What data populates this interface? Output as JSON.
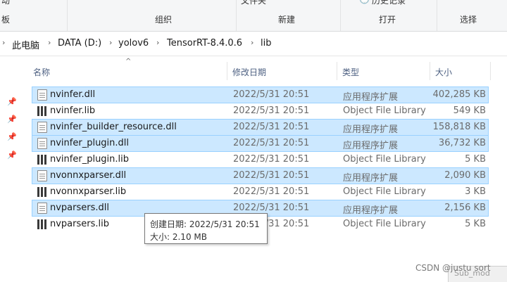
{
  "ribbon": {
    "clip_left_top": "动",
    "clip_left_bottom": "板",
    "clip_mid_top": "文件夹",
    "clip_right_top": "历史记录",
    "groups": {
      "organize": "组织",
      "new": "新建",
      "open": "打开",
      "select": "选择"
    }
  },
  "address": {
    "crumbs": [
      "此电脑",
      "DATA (D:)",
      "yolov6",
      "TensorRT-8.4.0.6",
      "lib"
    ]
  },
  "columns": {
    "name": "名称",
    "modified": "修改日期",
    "type": "类型",
    "size": "大小"
  },
  "files": [
    {
      "name": "nvinfer.dll",
      "modified": "2022/5/31 20:51",
      "type": "应用程序扩展",
      "size": "402,285 KB",
      "icon": "dll-file-icon",
      "selected": true
    },
    {
      "name": "nvinfer.lib",
      "modified": "2022/5/31 20:51",
      "type": "Object File Library",
      "size": "549 KB",
      "icon": "lib-file-icon",
      "selected": false
    },
    {
      "name": "nvinfer_builder_resource.dll",
      "modified": "2022/5/31 20:51",
      "type": "应用程序扩展",
      "size": "158,818 KB",
      "icon": "dll-file-icon",
      "selected": true
    },
    {
      "name": "nvinfer_plugin.dll",
      "modified": "2022/5/31 20:51",
      "type": "应用程序扩展",
      "size": "36,732 KB",
      "icon": "dll-file-icon",
      "selected": true
    },
    {
      "name": "nvinfer_plugin.lib",
      "modified": "2022/5/31 20:51",
      "type": "Object File Library",
      "size": "5 KB",
      "icon": "lib-file-icon",
      "selected": false
    },
    {
      "name": "nvonnxparser.dll",
      "modified": "2022/5/31 20:51",
      "type": "应用程序扩展",
      "size": "2,090 KB",
      "icon": "dll-file-icon",
      "selected": true
    },
    {
      "name": "nvonnxparser.lib",
      "modified": "2022/5/31 20:51",
      "type": "Object File Library",
      "size": "3 KB",
      "icon": "lib-file-icon",
      "selected": false
    },
    {
      "name": "nvparsers.dll",
      "modified": "2022/5/31 20:51",
      "type": "应用程序扩展",
      "size": "2,156 KB",
      "icon": "dll-file-icon",
      "selected": true
    },
    {
      "name": "nvparsers.lib",
      "modified": "2022/5/31 20:51",
      "type": "Object File Library",
      "size": "5 KB",
      "icon": "lib-file-icon",
      "selected": false
    }
  ],
  "tooltip": {
    "created": "创建日期: 2022/5/31 20:51",
    "size": "大小: 2.10 MB"
  },
  "watermark": "CSDN @justu sort",
  "bottom_clip": "Sub_mod",
  "colors": {
    "selection_bg": "#cce8ff",
    "selection_border": "#99d1ff",
    "header_text": "#4d6082"
  }
}
